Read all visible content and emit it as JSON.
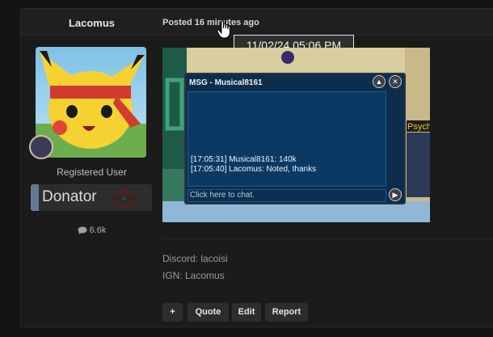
{
  "post": {
    "username": "Lacomus",
    "posted": "Posted 16 minutes ago",
    "tooltip": "11/02/24 05:06  PM",
    "user_title": "Registered User",
    "donator_label": "Donator",
    "message_count": "6.6k"
  },
  "chat": {
    "title": "MSG - Musical8161",
    "lines": [
      "[17:05:31] Musical8161: 140k",
      "[17:05:40] Lacomus: Noted, thanks"
    ],
    "input_placeholder": "Click here to chat.",
    "side_label": "Psych"
  },
  "signature": {
    "line1": "Discord: lacoisi",
    "line2": "IGN: Lacomus"
  },
  "buttons": {
    "plus": "+",
    "quote": "Quote",
    "edit": "Edit",
    "report": "Report"
  },
  "icons": {
    "cursor": "hand-pointer-icon",
    "comment": "comment-icon",
    "pokeball": "pokeball-icon"
  },
  "colors": {
    "background": "#141414",
    "panel": "#1b1b1b",
    "chat_bg": "#0a3a63",
    "donator_stripe": "#637a96"
  }
}
